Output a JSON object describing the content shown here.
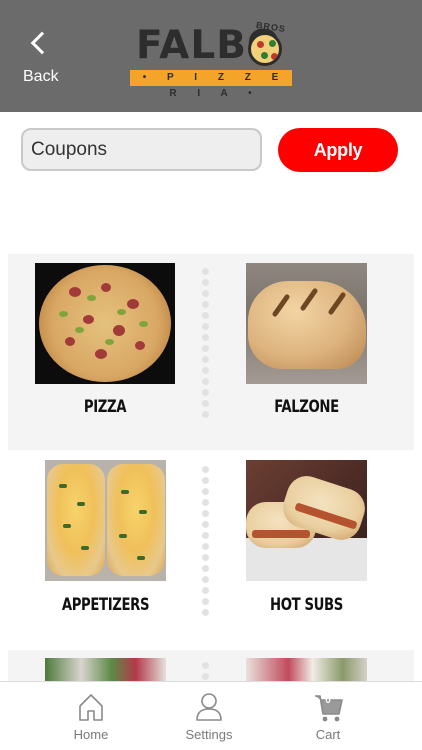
{
  "header": {
    "back_label": "Back",
    "logo": {
      "wordmark": "FALBO",
      "sub_mark": "BROS",
      "tagline": "• P I Z Z E R I A •"
    }
  },
  "coupon": {
    "placeholder": "Coupons",
    "apply_label": "Apply"
  },
  "categories": [
    {
      "label": "PIZZA",
      "image": "pizza-photo"
    },
    {
      "label": "FALZONE",
      "image": "falzone-photo"
    },
    {
      "label": "APPETIZERS",
      "image": "appetizers-photo"
    },
    {
      "label": "HOT SUBS",
      "image": "hot-subs-photo"
    },
    {
      "label": "",
      "image": "salad-photo"
    },
    {
      "label": "",
      "image": "dessert-photo"
    }
  ],
  "tabbar": {
    "home_label": "Home",
    "settings_label": "Settings",
    "cart_label": "Cart",
    "cart_count": "0"
  },
  "colors": {
    "header_bg": "#6b6b6b",
    "accent": "#ff0000",
    "logo_band": "#f4a428",
    "row_shade": "#f4f4f4"
  },
  "icons": [
    "chevron-left-icon",
    "home-icon",
    "user-icon",
    "cart-icon"
  ]
}
